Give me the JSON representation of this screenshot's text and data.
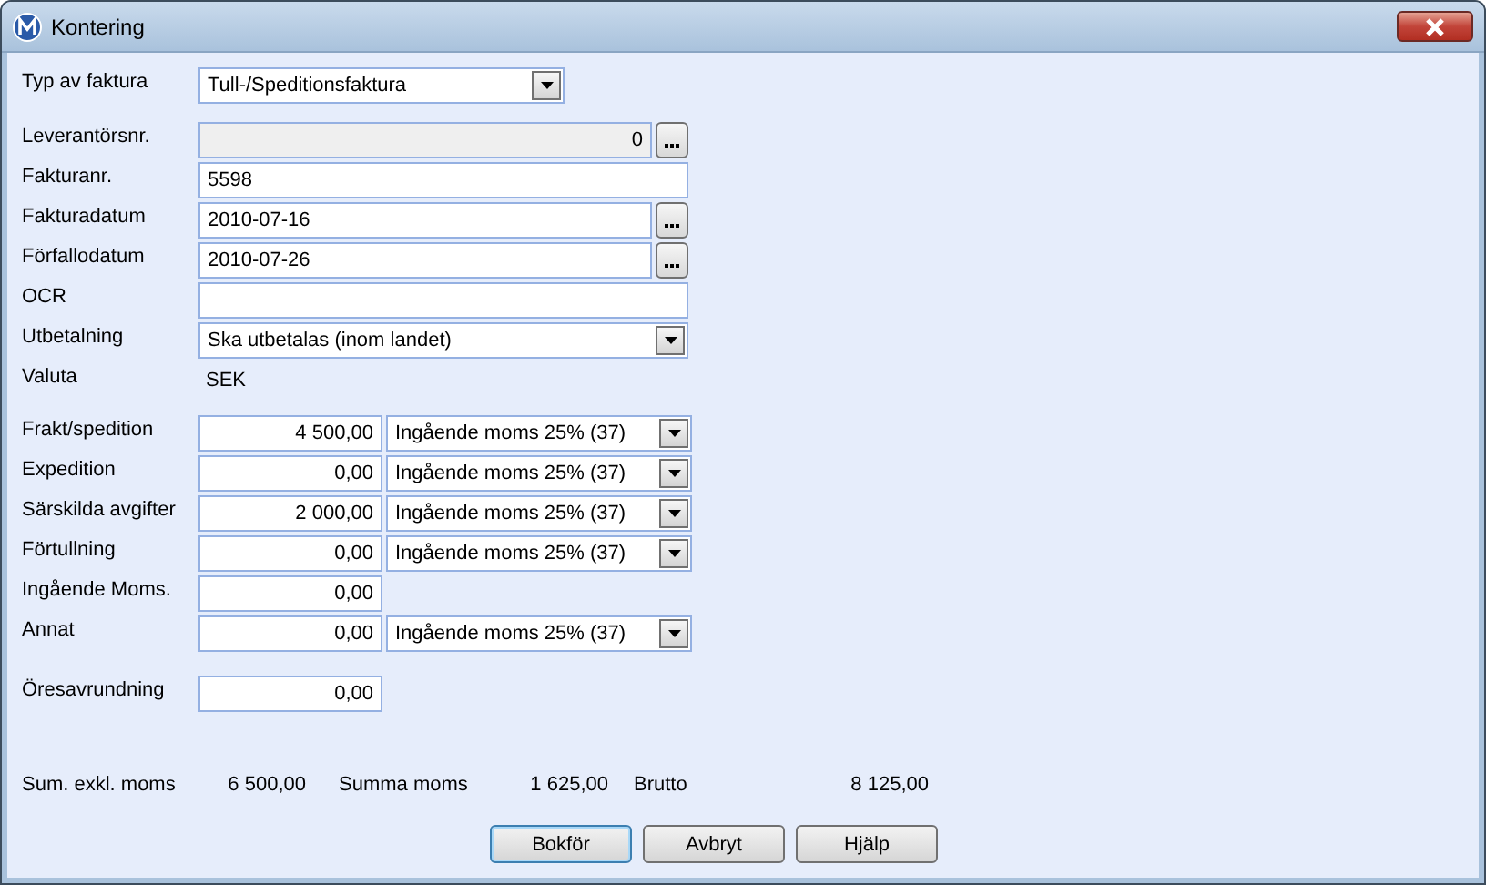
{
  "window": {
    "title": "Kontering"
  },
  "invoice_type": {
    "label": "Typ av faktura",
    "value": "Tull-/Speditionsfaktura"
  },
  "fields": [
    {
      "kind": "number_lookup",
      "label": "Leverantörsnr.",
      "value": "0",
      "disabled": true
    },
    {
      "kind": "text",
      "label": "Fakturanr.",
      "value": "5598",
      "disabled": false
    },
    {
      "kind": "lookup",
      "label": "Fakturadatum",
      "value": "2010-07-16",
      "disabled": false
    },
    {
      "kind": "lookup",
      "label": "Förfallodatum",
      "value": "2010-07-26",
      "disabled": false
    },
    {
      "kind": "text",
      "label": "OCR",
      "disabled": false
    },
    {
      "kind": "combo",
      "label": "Utbetalning",
      "value": "Ska utbetalas (inom landet)",
      "disabled": false
    },
    {
      "kind": "static",
      "label": "Valuta",
      "value": "SEK"
    }
  ],
  "costs": [
    {
      "kind": "with_vat",
      "label": "Frakt/spedition",
      "amount": "4 500,00",
      "vat": "Ingående moms 25% (37)"
    },
    {
      "kind": "with_vat",
      "label": "Expedition",
      "amount": "0,00",
      "vat": "Ingående moms 25% (37)"
    },
    {
      "kind": "with_vat",
      "label": "Särskilda avgifter",
      "amount": "2 000,00",
      "vat": "Ingående moms 25% (37)"
    },
    {
      "kind": "with_vat",
      "label": "Förtullning",
      "amount": "0,00",
      "vat": "Ingående moms 25% (37)"
    },
    {
      "kind": "plain",
      "label": "Ingående Moms.",
      "amount": "0,00"
    },
    {
      "kind": "with_vat",
      "label": "Annat",
      "amount": "0,00",
      "vat": "Ingående moms 25% (37)"
    }
  ],
  "rounding": {
    "label": "Öresavrundning",
    "amount": "0,00"
  },
  "totals": [
    {
      "label": "Sum. exkl. moms",
      "value": "6 500,00"
    },
    {
      "label": "Summa moms",
      "value": "1 625,00"
    },
    {
      "label": "Brutto",
      "value": "8 125,00"
    }
  ],
  "buttons": [
    {
      "label": "Bokför",
      "selected": true
    },
    {
      "label": "Avbryt",
      "selected": false
    },
    {
      "label": "Hjälp",
      "selected": false
    }
  ]
}
